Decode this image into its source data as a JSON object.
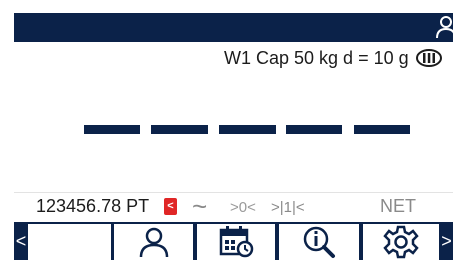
{
  "header": {
    "user_icon": "user-icon"
  },
  "scale_info": {
    "text": "W1 Cap 50 kg d = 10 g",
    "accuracy_class_icon": "accuracy-class-III-icon"
  },
  "weight": {
    "display": "-----",
    "dash_count": 5
  },
  "status": {
    "tare_value": "123456.78 PT",
    "zero_tracking_icon": "zero-tracking-icon",
    "zero_tracking_symbol": "<",
    "motion_icon": "motion-icon",
    "motion_symbol": "~",
    "center_zero_text": ">0<",
    "range_text": ">|1|<",
    "net_label": "NET"
  },
  "softkeys": {
    "prev_arrow": "<",
    "next_arrow": ">",
    "items": [
      {
        "icon": "blank"
      },
      {
        "icon": "user-icon"
      },
      {
        "icon": "calendar-clock-icon"
      },
      {
        "icon": "info-magnifier-icon"
      },
      {
        "icon": "gear-icon"
      }
    ]
  },
  "colors": {
    "navy": "#0b2249",
    "red": "#e02626",
    "gray": "#8a8a8a"
  }
}
